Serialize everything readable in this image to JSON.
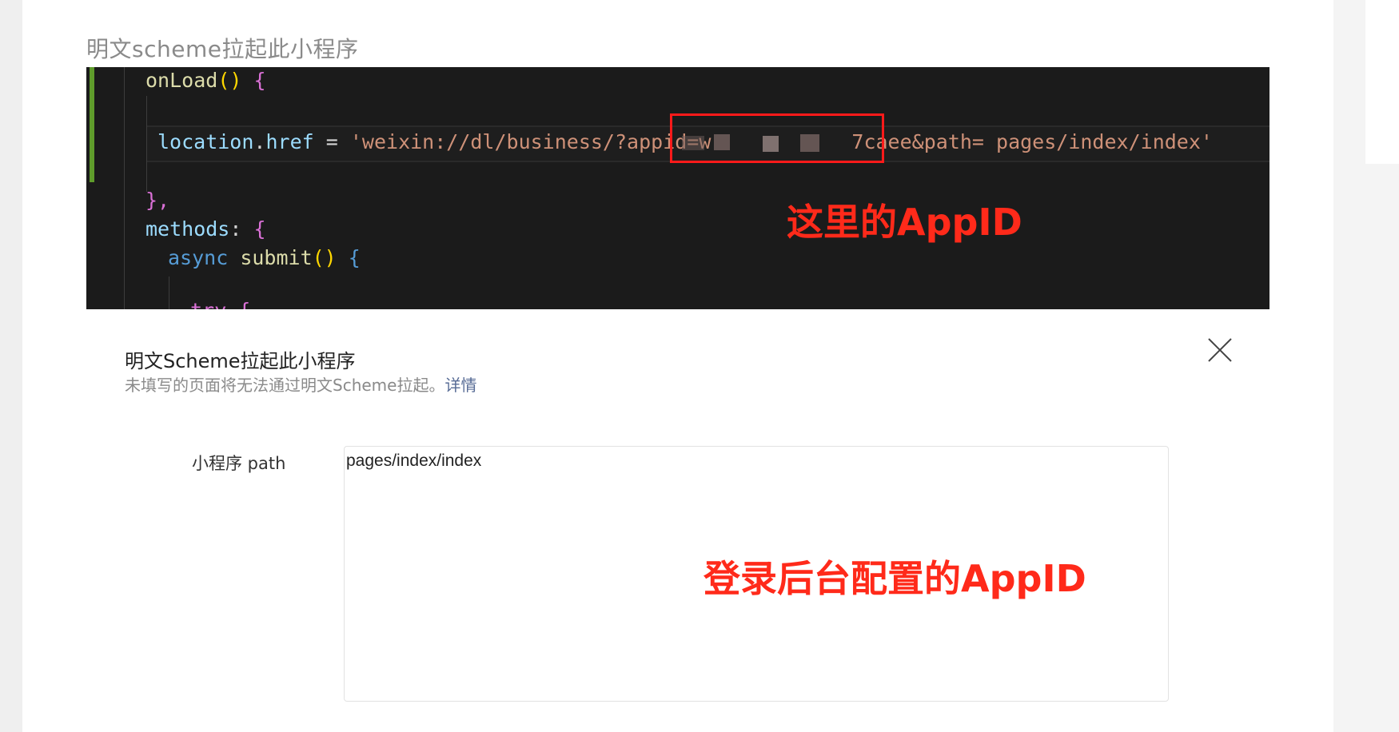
{
  "section_title": "明文scheme拉起此小程序",
  "code": {
    "line1": {
      "func": "onLoad",
      "parens": "()",
      "brace": "{"
    },
    "line2": {
      "obj": "location",
      "dot": ".",
      "prop": "href",
      "op": " = ",
      "str_start": "'weixin://dl/business/?appid=w",
      "str_end": "7caee&path= pages/index/index'"
    },
    "line3": {
      "text": "},"
    },
    "line4": {
      "key": "methods",
      "colon": ": ",
      "brace": "{"
    },
    "line5": {
      "kw": "async",
      "func": " submit",
      "parens": "()",
      "brace": " {"
    },
    "line6": {
      "text": "try {"
    }
  },
  "annotation_code": "这里的AppID",
  "dialog": {
    "title": "明文Scheme拉起此小程序",
    "description": "未填写的页面将无法通过明文Scheme拉起。",
    "detail_link": "详情",
    "close_icon": "close-icon",
    "field_label": "小程序 path",
    "path_value": "pages/index/index"
  },
  "annotation_dialog": "登录后台配置的AppID",
  "colors": {
    "annotation": "#ff2a1a",
    "link": "#576b95",
    "editor_bg": "#1b1b1b"
  }
}
